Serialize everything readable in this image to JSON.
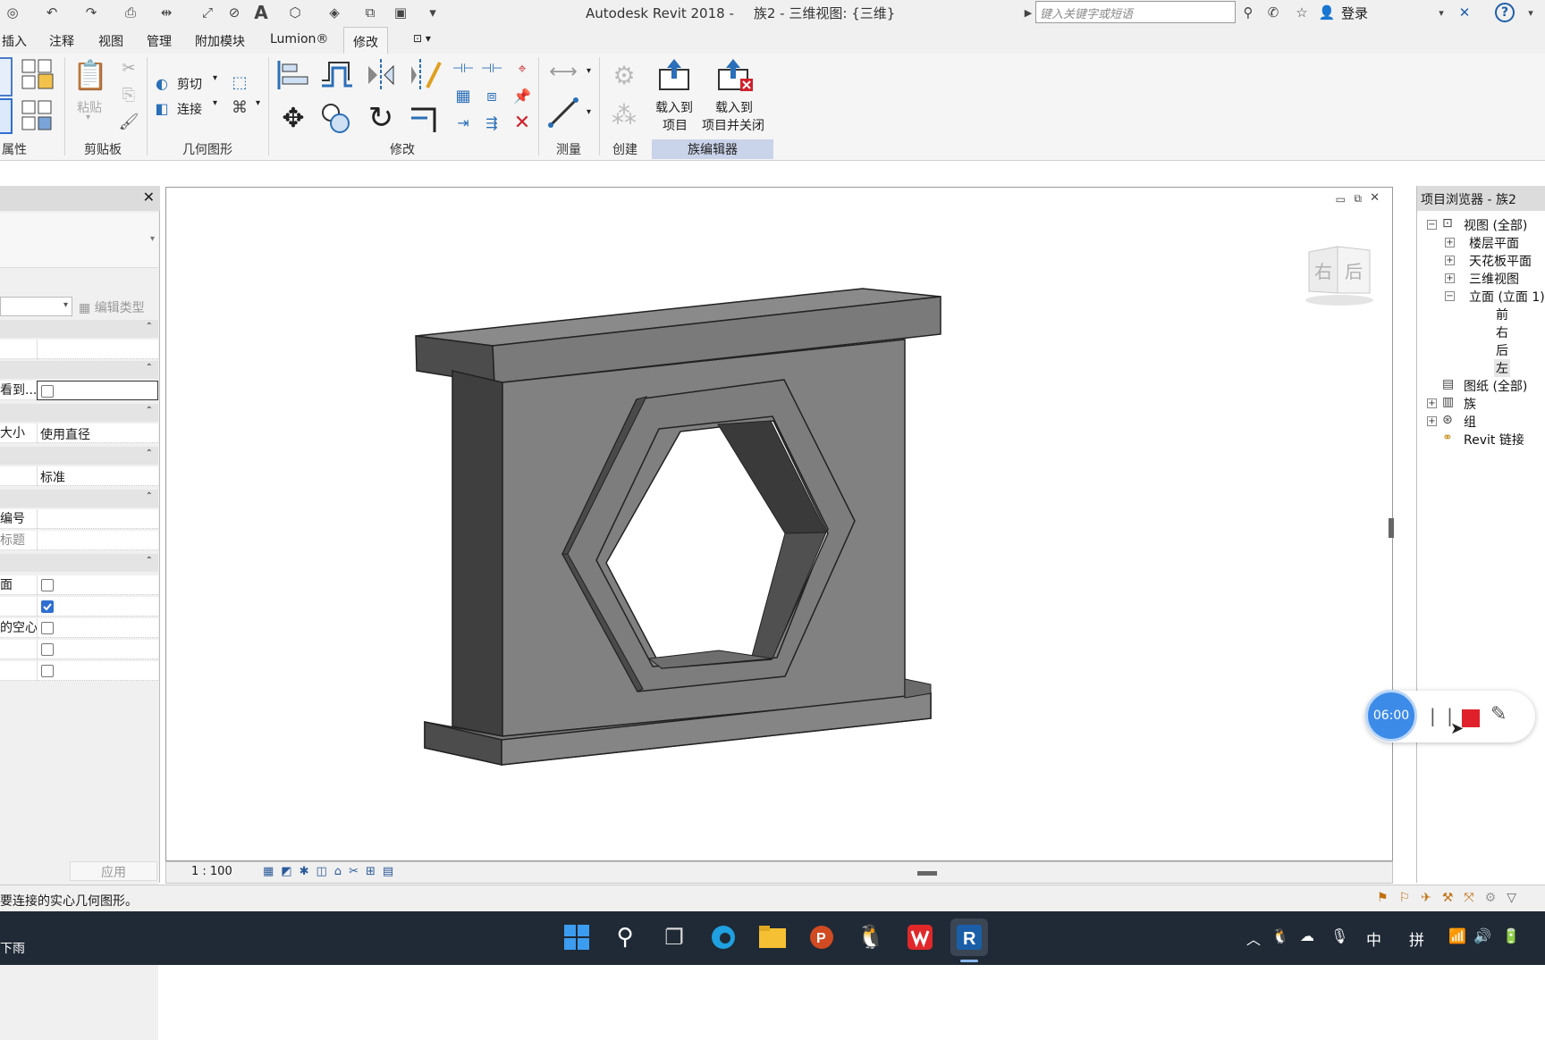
{
  "titlebar": {
    "app_title": "Autodesk Revit 2018 -",
    "doc_title": "族2 - 三维视图: {三维}",
    "search_placeholder": "键入关键字或短语",
    "login_label": "登录",
    "help_label": "?"
  },
  "tabs": [
    "插入",
    "注释",
    "视图",
    "管理",
    "附加模块",
    "Lumion®",
    "修改"
  ],
  "active_tab": "修改",
  "ribbon": {
    "groups": {
      "properties": "属性",
      "clipboard": "剪贴板",
      "geometry": "几何图形",
      "modify": "修改",
      "measure": "测量",
      "create": "创建",
      "family_editor": "族编辑器"
    },
    "paste_label": "粘贴",
    "cut_label": "剪切",
    "join_label": "连接",
    "load_into_project": [
      "载入到",
      "项目"
    ],
    "load_into_project_close": [
      "载入到",
      "项目并关闭"
    ]
  },
  "properties": {
    "edit_type_label": "编辑类型",
    "rows": [
      {
        "key": "",
        "value": ""
      },
      {
        "key": "看到...",
        "checkbox": false
      },
      {
        "key": "大小",
        "value": "使用直径"
      },
      {
        "key": "",
        "value": "标准"
      },
      {
        "key": "编号",
        "value": ""
      },
      {
        "key": "标题",
        "value": ""
      },
      {
        "key": "面",
        "checkbox": false
      },
      {
        "key": "",
        "checkbox": true
      },
      {
        "key": "的空心",
        "checkbox": false
      },
      {
        "key": "",
        "checkbox": false
      },
      {
        "key": "",
        "checkbox": false
      }
    ],
    "apply_label": "应用"
  },
  "viewport": {
    "scale": "1 : 100",
    "viewcube_faces": [
      "右",
      "后"
    ]
  },
  "browser": {
    "title": "项目浏览器 - 族2",
    "items": [
      {
        "label": "视图 (全部)",
        "level": 0,
        "toggle": "−"
      },
      {
        "label": "楼层平面",
        "level": 1,
        "toggle": "+"
      },
      {
        "label": "天花板平面",
        "level": 1,
        "toggle": "+"
      },
      {
        "label": "三维视图",
        "level": 1,
        "toggle": "+"
      },
      {
        "label": "立面 (立面 1)",
        "level": 1,
        "toggle": "−"
      },
      {
        "label": "前",
        "level": 2
      },
      {
        "label": "右",
        "level": 2
      },
      {
        "label": "后",
        "level": 2
      },
      {
        "label": "左",
        "level": 2
      },
      {
        "label": "图纸 (全部)",
        "level": 0
      },
      {
        "label": "族",
        "level": 0,
        "toggle": "+"
      },
      {
        "label": "组",
        "level": 0,
        "toggle": "+"
      },
      {
        "label": "Revit 链接",
        "level": 0
      }
    ]
  },
  "status": {
    "message": "要连接的实心几何图形。"
  },
  "recorder": {
    "time": "06:00"
  },
  "taskbar": {
    "weather": "下雨",
    "ime_mode": "中",
    "ime_name": "拼"
  },
  "colors": {
    "accent": "#2f6fd0",
    "taskbar": "#1f2a36",
    "family_editor_bg": "#c9d3ea"
  }
}
